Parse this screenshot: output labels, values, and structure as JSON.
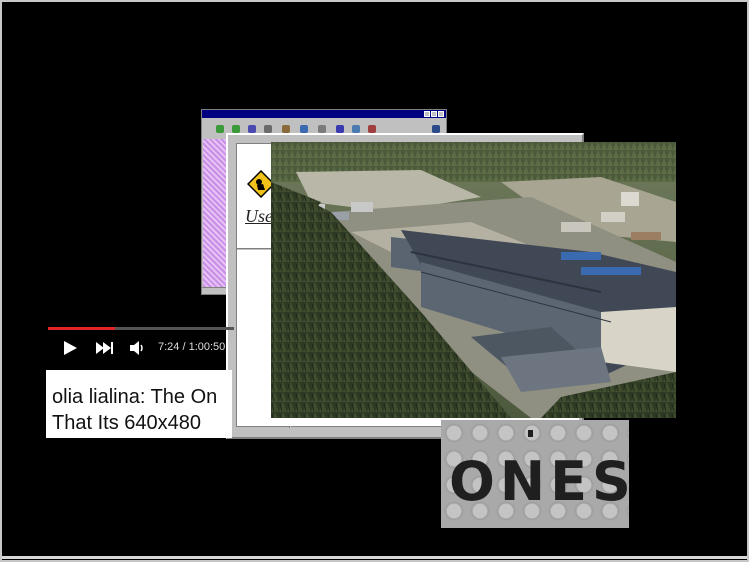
{
  "video_player": {
    "progress_fraction": 0.361,
    "time_display": "7:24 / 1:00:50",
    "play_icon": "play-icon",
    "next_icon": "next-icon",
    "volume_icon": "volume-icon"
  },
  "caption": {
    "line1": "olia lialina: The On",
    "line2": "That Its 640x480"
  },
  "ones_card": {
    "text": "ONES"
  },
  "dialog": {
    "label": "Use",
    "icon": "warning-icon"
  },
  "colors": {
    "background": "#000000",
    "progress_red": "#e32525",
    "win95_blue": "#000080",
    "win95_gray": "#c0c0c0"
  }
}
